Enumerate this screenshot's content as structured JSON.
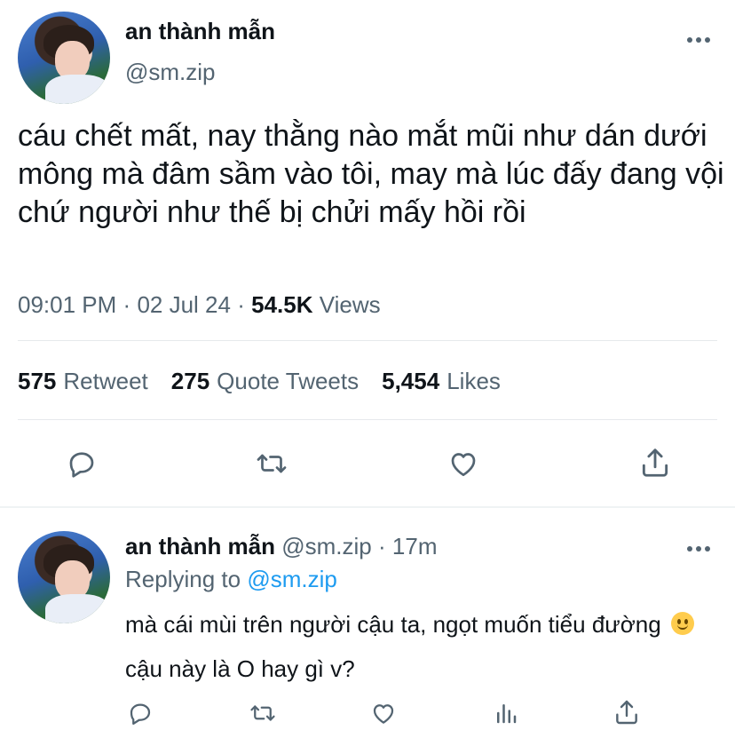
{
  "tweet": {
    "author_name": "an thành mẫn",
    "author_handle": "@sm.zip",
    "text": "cáu chết mất, nay thằng nào mắt mũi như dán dưới mông mà đâm sầm vào tôi, may mà lúc đấy đang vội chứ người như thế bị chửi mấy hồi rồi",
    "time": "09:01 PM",
    "separator": "·",
    "date": "02 Jul 24",
    "views_count": "54.5K",
    "views_label": "Views",
    "stats": {
      "retweets_count": "575",
      "retweets_label": "Retweet",
      "quotes_count": "275",
      "quotes_label": "Quote Tweets",
      "likes_count": "5,454",
      "likes_label": "Likes"
    },
    "actions": [
      "reply-icon",
      "retweet-icon",
      "like-icon",
      "share-icon"
    ]
  },
  "reply": {
    "author_name": "an thành mẫn",
    "author_handle": "@sm.zip",
    "separator": "·",
    "age": "17m",
    "replying_label": "Replying to",
    "replying_to": "@sm.zip",
    "text_before_emoji": "mà cái mùi trên người cậu ta, ngọt muốn tiểu đường",
    "text_after_emoji": "cậu này là O hay gì v?",
    "emoji": "slightly-smiling-face",
    "actions": [
      "reply-icon",
      "retweet-icon",
      "like-icon",
      "analytics-icon",
      "share-icon"
    ]
  },
  "colors": {
    "primary_text": "#0f1419",
    "secondary_text": "#536471",
    "link": "#1d9bf0",
    "divider": "#e6e9ec"
  }
}
